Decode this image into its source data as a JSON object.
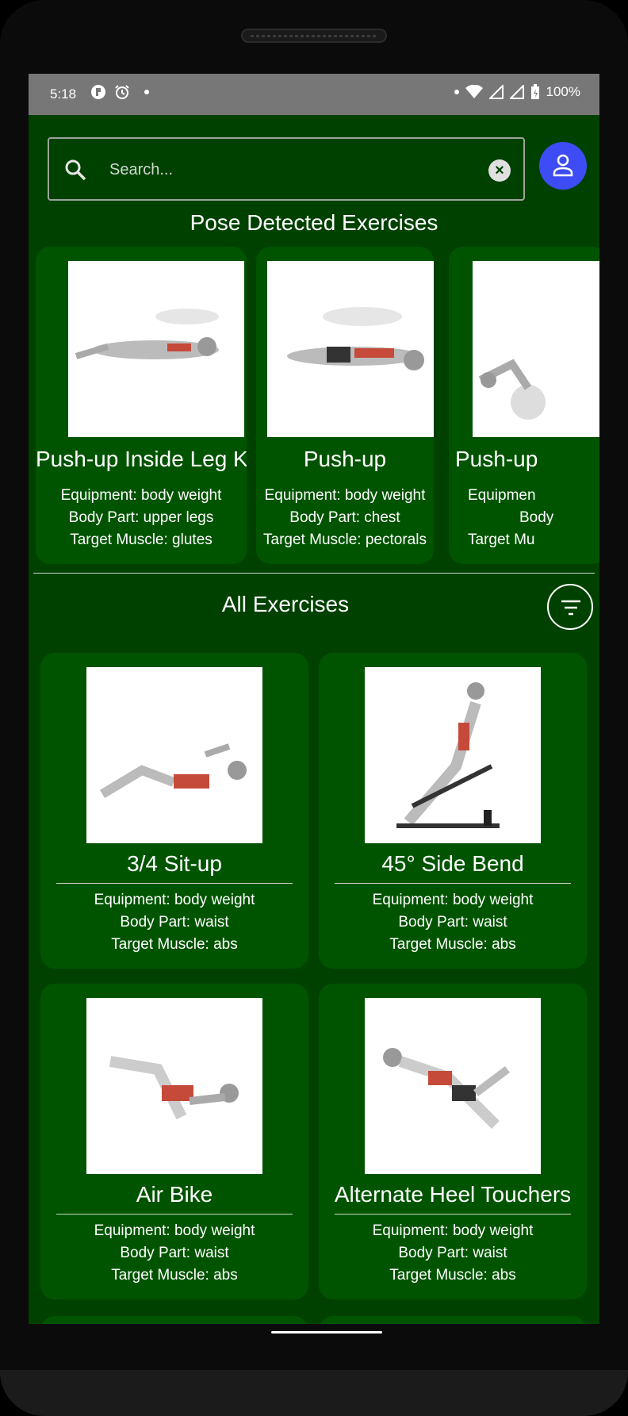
{
  "status_bar": {
    "time": "5:18",
    "battery": "100%"
  },
  "search": {
    "placeholder": "Search..."
  },
  "pose_section": {
    "title": "Pose Detected Exercises",
    "cards": [
      {
        "name": "Push-up Inside Leg Kick",
        "equipment": "Equipment: body weight",
        "body_part": "Body Part: upper legs",
        "target": "Target Muscle: glutes"
      },
      {
        "name": "Push-up",
        "equipment": "Equipment: body weight",
        "body_part": "Body Part: chest",
        "target": "Target Muscle: pectorals"
      },
      {
        "name": "Push-up",
        "equipment": "Equipmen",
        "body_part": "Body",
        "target": "Target Mu"
      }
    ]
  },
  "all_section": {
    "title": "All Exercises",
    "cards": [
      {
        "name": "3/4 Sit-up",
        "equipment": "Equipment: body weight",
        "body_part": "Body Part: waist",
        "target": "Target Muscle: abs"
      },
      {
        "name": "45° Side Bend",
        "equipment": "Equipment: body weight",
        "body_part": "Body Part: waist",
        "target": "Target Muscle: abs"
      },
      {
        "name": "Air Bike",
        "equipment": "Equipment: body weight",
        "body_part": "Body Part: waist",
        "target": "Target Muscle: abs"
      },
      {
        "name": "Alternate Heel Touchers",
        "equipment": "Equipment: body weight",
        "body_part": "Body Part: waist",
        "target": "Target Muscle: abs"
      }
    ]
  },
  "colors": {
    "background": "#004100",
    "card": "#005400",
    "accent": "#3d4cf5",
    "status_bar": "#777777"
  }
}
